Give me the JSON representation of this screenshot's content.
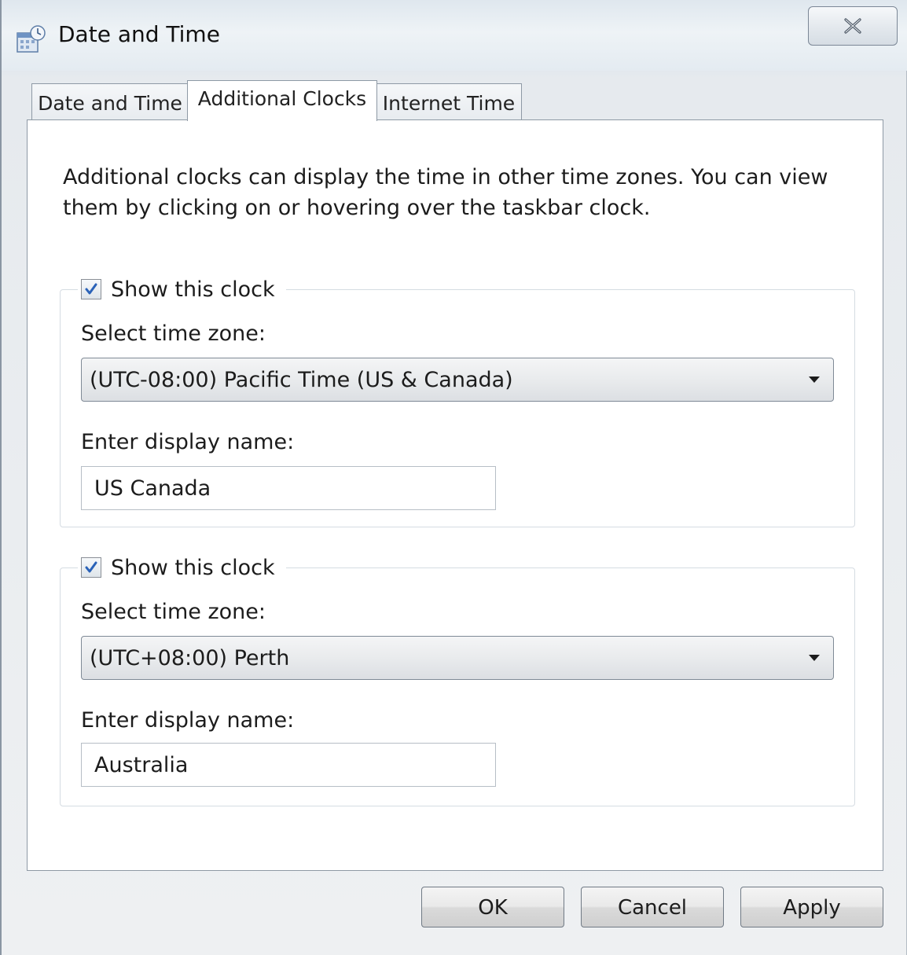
{
  "window": {
    "title": "Date and Time",
    "icon": "date-time-window-icon",
    "close_icon": "close-icon"
  },
  "tabs": [
    {
      "label": "Date and Time",
      "active": false
    },
    {
      "label": "Additional Clocks",
      "active": true
    },
    {
      "label": "Internet Time",
      "active": false
    }
  ],
  "description": "Additional clocks can display the time in other time zones. You can view them by clicking on or hovering over the taskbar clock.",
  "clocks": [
    {
      "show_label": "Show this clock",
      "show_checked": true,
      "timezone_label": "Select time zone:",
      "timezone_value": "(UTC-08:00) Pacific Time (US & Canada)",
      "display_name_label": "Enter display name:",
      "display_name_value": "US Canada"
    },
    {
      "show_label": "Show this clock",
      "show_checked": true,
      "timezone_label": "Select time zone:",
      "timezone_value": "(UTC+08:00) Perth",
      "display_name_label": "Enter display name:",
      "display_name_value": "Australia"
    }
  ],
  "buttons": {
    "ok": "OK",
    "cancel": "Cancel",
    "apply": "Apply"
  },
  "colors": {
    "checkmark": "#2a62b8",
    "panel_border": "#8e99a5"
  }
}
